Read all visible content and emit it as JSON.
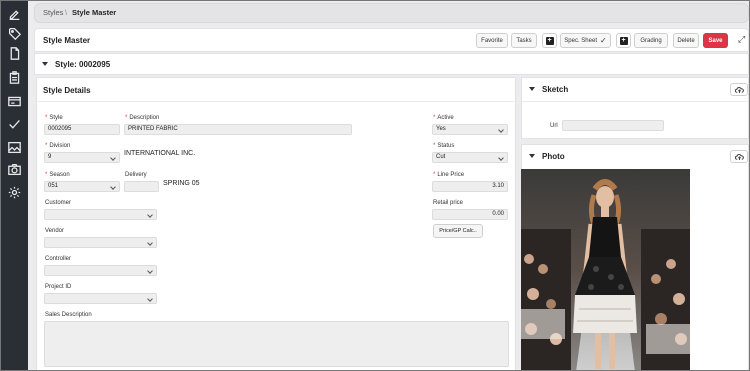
{
  "sidebar": {
    "icons": [
      "edit-icon",
      "tag-icon",
      "document-icon",
      "clipboard-icon",
      "card-icon",
      "check-icon",
      "image-icon",
      "camera-icon",
      "gear-icon"
    ]
  },
  "breadcrumb": {
    "root": "Styles",
    "separator": "\\",
    "current": "Style Master"
  },
  "header": {
    "title": "Style Master",
    "buttons": {
      "favorite": "Favorite",
      "tasks": "Tasks",
      "spec_sheet": "Spec. Sheet",
      "grading": "Grading",
      "delete": "Delete",
      "save": "Save"
    }
  },
  "style_heading": "Style: 0002095",
  "details": {
    "title": "Style Details",
    "style": {
      "label": "Style",
      "value": "0002095"
    },
    "description": {
      "label": "Description",
      "value": "PRINTED FABRIC"
    },
    "active": {
      "label": "Active",
      "value": "Yes"
    },
    "division": {
      "label": "Division",
      "value": "9",
      "text": "INTERNATIONAL INC."
    },
    "status": {
      "label": "Status",
      "value": "Cut"
    },
    "season": {
      "label": "Season",
      "value": "051"
    },
    "delivery": {
      "label": "Delivery",
      "value": "",
      "text": "SPRING 05"
    },
    "line_price": {
      "label": "Line Price",
      "value": "3.10"
    },
    "customer": {
      "label": "Customer",
      "value": ""
    },
    "retail_price": {
      "label": "Retail price",
      "value": "0.00"
    },
    "price_gp_button": "Price/GP Calc..",
    "vendor": {
      "label": "Vendor",
      "value": ""
    },
    "controller": {
      "label": "Controller",
      "value": ""
    },
    "project_id": {
      "label": "Project ID",
      "value": ""
    },
    "sales_description": {
      "label": "Sales Description",
      "value": ""
    }
  },
  "sketch": {
    "title": "Sketch",
    "url_label": "Url",
    "url_value": ""
  },
  "photo": {
    "title": "Photo"
  },
  "colors": {
    "save": "#dc3545",
    "required": "#dc3545",
    "sidebar": "#2a2e35"
  }
}
